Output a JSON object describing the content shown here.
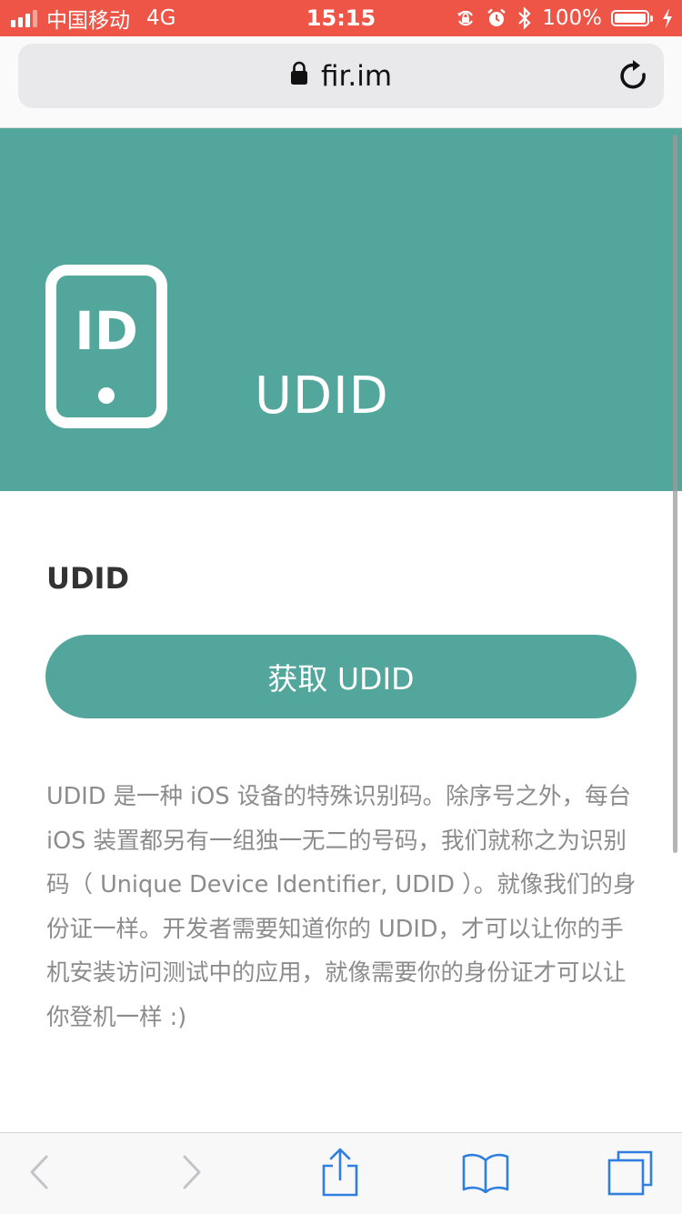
{
  "status_bar": {
    "carrier": "中国移动",
    "network": "4G",
    "time": "15:15",
    "battery_percent": "100%",
    "battery_level": 1.0,
    "icons": [
      "signal-icon",
      "orientation-lock-icon",
      "alarm-icon",
      "bluetooth-icon",
      "battery-icon",
      "charging-icon"
    ]
  },
  "address_bar": {
    "url": "fir.im",
    "icons": [
      "lock-icon",
      "reload-icon"
    ]
  },
  "hero": {
    "icon_text": "ID",
    "title": "UDID"
  },
  "content": {
    "section_title": "UDID",
    "button_label": "获取 UDID",
    "description": "UDID 是一种 iOS 设备的特殊识别码。除序号之外，每台 iOS 装置都另有一组独一无二的号码，我们就称之为识别码（ Unique Device Identifier, UDID ）。就像我们的身份证一样。开发者需要知道你的 UDID，才可以让你的手机安装访问测试中的应用，就像需要你的身份证才可以让你登机一样 :)"
  },
  "toolbar": {
    "icons": [
      "back-icon",
      "forward-icon",
      "share-icon",
      "bookmarks-icon",
      "tabs-icon"
    ]
  },
  "colors": {
    "status_bar": "#ee5546",
    "accent": "#52a69b",
    "toolbar_icon": "#2f7fe0",
    "toolbar_icon_disabled": "#c4c4c8",
    "description_text": "#8c8c8c"
  }
}
